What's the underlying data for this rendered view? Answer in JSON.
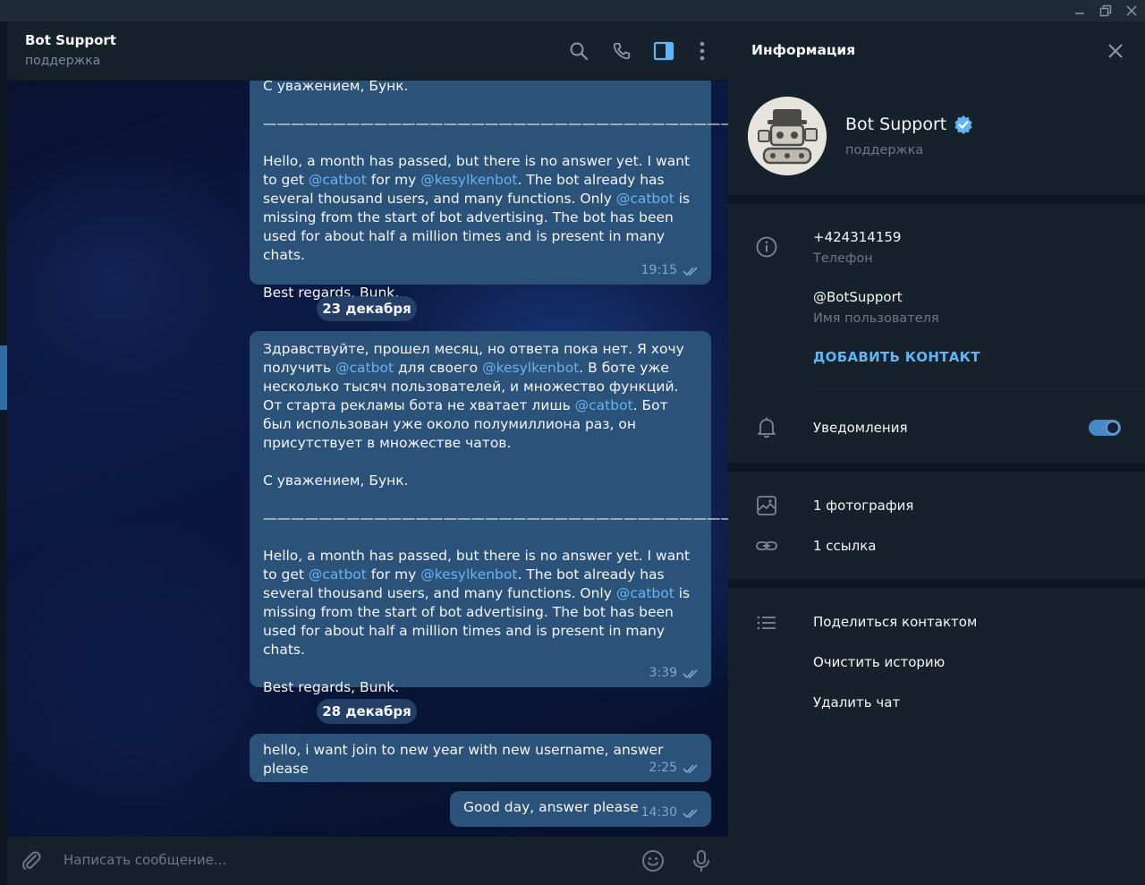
{
  "chat": {
    "title": "Bot Support",
    "subtitle": "поддержка",
    "composer_placeholder": "Написать сообщение..."
  },
  "messages": [
    {
      "id": "m1",
      "parts": [
        {
          "t": "С уважением, Бунк."
        },
        {
          "t": "\n\n——————————————————————————————————\n\nHello, a month has passed, but there is no answer yet. I want to get "
        },
        {
          "t": "@catbot",
          "m": true
        },
        {
          "t": " for my "
        },
        {
          "t": "@kesylkenbot",
          "m": true
        },
        {
          "t": ". The bot already has several thousand users, and many functions. Only "
        },
        {
          "t": "@catbot",
          "m": true
        },
        {
          "t": " is missing from the start of bot advertising. The bot has been used for about half a million times and is present in many chats.\n\nBest regards, Bunk."
        }
      ],
      "time": "19:15"
    },
    {
      "id": "m2",
      "parts": [
        {
          "t": "Здравствуйте, прошел месяц, но ответа пока нет. Я хочу получить "
        },
        {
          "t": "@catbot",
          "m": true
        },
        {
          "t": " для своего "
        },
        {
          "t": "@kesylkenbot",
          "m": true
        },
        {
          "t": ". В боте уже несколько тысяч пользователей, и множество функций. От старта рекламы бота не хватает лишь "
        },
        {
          "t": "@catbot",
          "m": true
        },
        {
          "t": ". Бот был использован уже около полумиллиона раз, он присутствует в множестве чатов.\n\nС уважением, Бунк.\n\n——————————————————————————————————\n\nHello, a month has passed, but there is no answer yet. I want to get "
        },
        {
          "t": "@catbot",
          "m": true
        },
        {
          "t": " for my "
        },
        {
          "t": "@kesylkenbot",
          "m": true
        },
        {
          "t": ". The bot already has several thousand users, and many functions. Only "
        },
        {
          "t": "@catbot",
          "m": true
        },
        {
          "t": " is missing from the start of bot advertising. The bot has been used for about half a million times and is present in many chats.\n\nBest regards, Bunk."
        }
      ],
      "time": "3:39"
    },
    {
      "id": "m3",
      "parts": [
        {
          "t": "hello, i want join to new year with new username, answer please"
        }
      ],
      "time": "2:25"
    },
    {
      "id": "m4",
      "parts": [
        {
          "t": "Good day, answer please"
        }
      ],
      "time": "14:30"
    }
  ],
  "dates": [
    "23 декабря",
    "28 декабря"
  ],
  "info": {
    "title": "Информация",
    "name": "Bot Support",
    "status": "поддержка",
    "phone": "+424314159",
    "phone_label": "Телефон",
    "username": "@BotSupport",
    "username_label": "Имя пользователя",
    "add_contact": "ДОБАВИТЬ КОНТАКТ",
    "notifications": "Уведомления",
    "notifications_on": true,
    "photos": "1 фотография",
    "links": "1 ссылка",
    "actions": [
      "Поделиться контактом",
      "Очистить историю",
      "Удалить чат"
    ]
  },
  "colors": {
    "bubble": "#2b5278",
    "mention": "#6ab3f3",
    "accent": "#5eb5f7",
    "panel_bg": "#17212b"
  }
}
